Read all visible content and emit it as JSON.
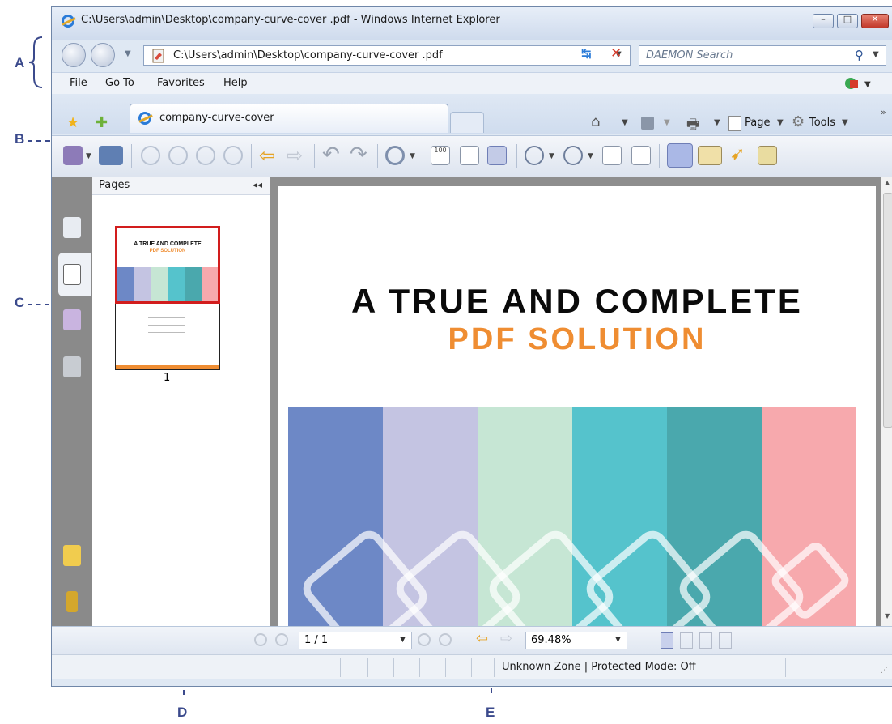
{
  "window": {
    "title": "C:\\Users\\admin\\Desktop\\company-curve-cover .pdf - Windows Internet Explorer"
  },
  "nav": {
    "address": "C:\\Users\\admin\\Desktop\\company-curve-cover .pdf",
    "search_placeholder": "DAEMON Search"
  },
  "menu": [
    "File",
    "Go To",
    "Favorites",
    "Help"
  ],
  "tab": {
    "label": "company-curve-cover"
  },
  "commands": {
    "page": "Page",
    "tools": "Tools"
  },
  "pages_panel": {
    "label": "Pages",
    "thumbnail_number": "1"
  },
  "document": {
    "title_line1": "A TRUE AND COMPLETE",
    "title_line2": "PDF SOLUTION"
  },
  "thumbnail": {
    "title_line1": "A TRUE AND COMPLETE",
    "title_line2": "PDF SOLUTION"
  },
  "pagenav": {
    "page": "1 / 1",
    "zoom": "69.48%"
  },
  "status": {
    "text": "Unknown Zone | Protected Mode: Off"
  },
  "callouts": [
    "A",
    "B",
    "C",
    "D",
    "E"
  ],
  "colors": {
    "title_orange": "#ef8d32",
    "stripes": [
      "#6d88c6",
      "#c4c4e2",
      "#c6e6d4",
      "#55c3cc",
      "#4aa8ad",
      "#f7a9ad"
    ],
    "accent": "#3b4a8c"
  },
  "icons": [
    "ie-logo",
    "back-icon",
    "forward-icon",
    "refresh-icon",
    "stop-icon",
    "search-icon",
    "home-icon",
    "feeds-icon",
    "print-icon",
    "page-icon",
    "tools-icon",
    "save-icon",
    "zoom-in-icon",
    "hand-tool-icon",
    "select-tool-icon",
    "bookmarks-icon",
    "pages-icon",
    "comments-icon",
    "layers-icon",
    "attachments-icon"
  ]
}
